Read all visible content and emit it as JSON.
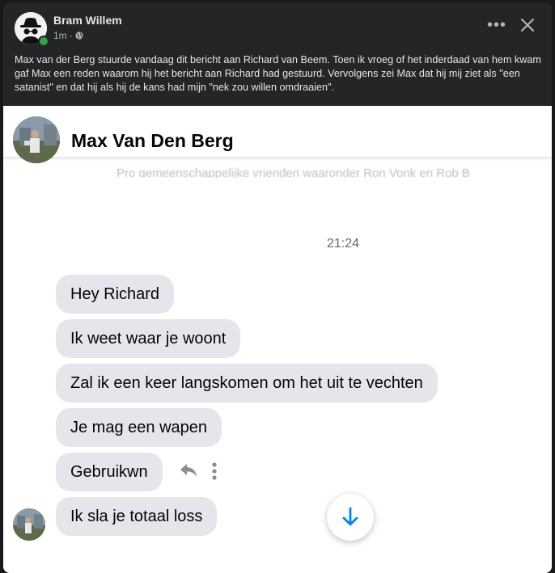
{
  "post": {
    "author": "Bram Willem",
    "time": "1m",
    "separator": "·",
    "text": "Max van der Berg stuurde vandaag dit bericht aan Richard van Beem. Toen ik vroeg of het inderdaad van hem kwam gaf Max een reden waarom hij het bericht aan Richard had gestuurd.  Vervolgens zei Max dat hij mij ziet als \"een satanist\" en dat hij als hij de kans had mijn \"nek zou willen omdraaien\".",
    "more_label": "•••"
  },
  "chat": {
    "contact_name": "Max Van Den Berg",
    "faded_text": "Pro gemeenschappelijke vrienden waaronder Ron Vonk en Rob B",
    "timestamp": "21:24",
    "messages": [
      "Hey Richard",
      "Ik weet waar je woont",
      "Zal ik een keer langskomen om het uit te vechten",
      "Je mag een wapen",
      "Gebruikwn",
      "Ik sla je totaal loss"
    ]
  },
  "colors": {
    "background": "#18191a",
    "card": "#242526",
    "bubble": "#e4e6eb",
    "accent": "#0084ff",
    "online": "#31a24c"
  },
  "icons": [
    "incognito-avatar",
    "globe-icon",
    "more-icon",
    "close-icon",
    "reply-icon",
    "more-vertical-icon",
    "arrow-down-icon"
  ]
}
